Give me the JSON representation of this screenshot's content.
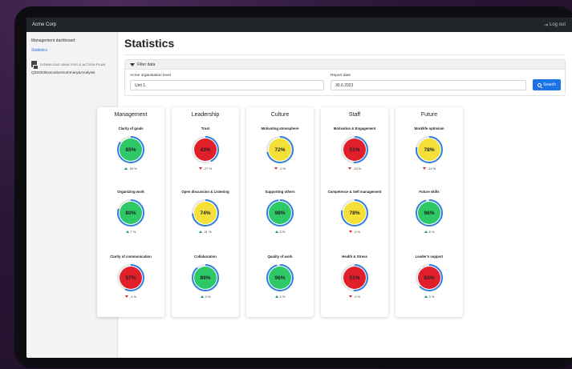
{
  "app": {
    "name": "Acme Corp",
    "logout_label": "Log out"
  },
  "sidebar": {
    "items": [
      {
        "label": "Management dashboard"
      },
      {
        "label": "Statistics"
      }
    ],
    "download_label": "DOWNLOAD ANALYSIS & ACTION PLAN",
    "file_label": "Q32023ExecutiveSummary&Analysis"
  },
  "page": {
    "title": "Statistics"
  },
  "filter": {
    "header": "Filter data",
    "org_label": "Acme organisation level",
    "org_value": "Unit 1.",
    "date_label": "Report date",
    "date_value": "30.6.2023",
    "search_label": "Search"
  },
  "colors": {
    "green": "#2ec866",
    "yellow": "#f5e03a",
    "red": "#e01f2b",
    "ring_blue": "#2f7fe0",
    "ring_track": "#e4e4e4"
  },
  "categories": [
    {
      "title": "Management",
      "metrics": [
        {
          "label": "Clarity of goals",
          "value": "85%",
          "fraction": 0.85,
          "status": "green",
          "trend": "33 %",
          "dir": "up"
        },
        {
          "label": "Organizing work",
          "value": "80%",
          "fraction": 0.8,
          "status": "green",
          "trend": "7 %",
          "dir": "up"
        },
        {
          "label": "Clarity of communication",
          "value": "57%",
          "fraction": 0.57,
          "status": "red",
          "trend": "-1 %",
          "dir": "down"
        }
      ]
    },
    {
      "title": "Leadership",
      "metrics": [
        {
          "label": "Trust",
          "value": "43%",
          "fraction": 0.43,
          "status": "red",
          "trend": "-27 %",
          "dir": "down"
        },
        {
          "label": "Open discussion & Listening",
          "value": "74%",
          "fraction": 0.74,
          "status": "yellow",
          "trend": "21 %",
          "dir": "up"
        },
        {
          "label": "Collaboration",
          "value": "89%",
          "fraction": 0.89,
          "status": "green",
          "trend": "3 %",
          "dir": "up"
        }
      ]
    },
    {
      "title": "Culture",
      "metrics": [
        {
          "label": "Motivating atmosphere",
          "value": "72%",
          "fraction": 0.72,
          "status": "yellow",
          "trend": "-1 %",
          "dir": "down"
        },
        {
          "label": "Supporting others",
          "value": "98%",
          "fraction": 0.98,
          "status": "green",
          "trend": "5 %",
          "dir": "up"
        },
        {
          "label": "Quality of work",
          "value": "96%",
          "fraction": 0.96,
          "status": "green",
          "trend": "1 %",
          "dir": "up"
        }
      ]
    },
    {
      "title": "Staff",
      "metrics": [
        {
          "label": "Motivation & Engagement",
          "value": "51%",
          "fraction": 0.51,
          "status": "red",
          "trend": "-13 %",
          "dir": "down"
        },
        {
          "label": "Competence & Self management",
          "value": "78%",
          "fraction": 0.78,
          "status": "yellow",
          "trend": "-2 %",
          "dir": "down"
        },
        {
          "label": "Health & Stress",
          "value": "51%",
          "fraction": 0.51,
          "status": "red",
          "trend": "-2 %",
          "dir": "down"
        }
      ]
    },
    {
      "title": "Future",
      "metrics": [
        {
          "label": "Worklife optimism",
          "value": "78%",
          "fraction": 0.78,
          "status": "yellow",
          "trend": "-12 %",
          "dir": "down"
        },
        {
          "label": "Future skills",
          "value": "96%",
          "fraction": 0.96,
          "status": "green",
          "trend": "8 %",
          "dir": "up"
        },
        {
          "label": "Leader's support",
          "value": "63%",
          "fraction": 0.63,
          "status": "red",
          "trend": "3 %",
          "dir": "up"
        }
      ]
    }
  ]
}
